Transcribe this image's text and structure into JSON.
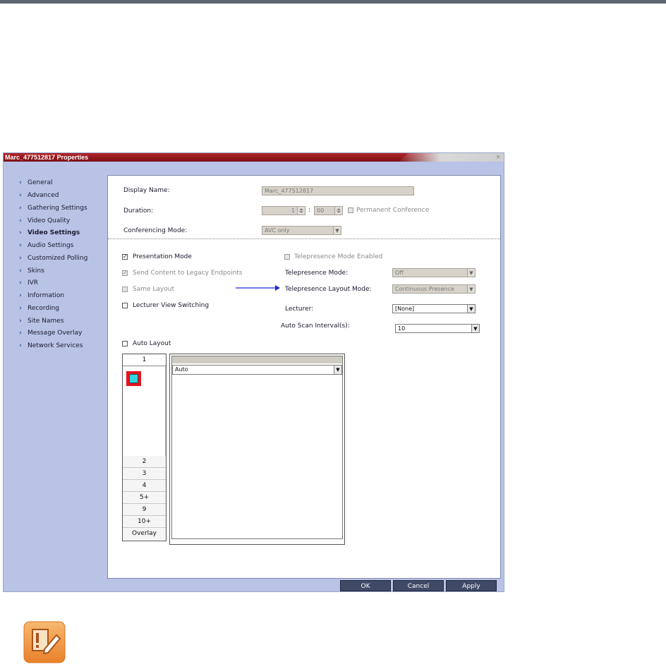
{
  "window": {
    "title": "Marc_477512817 Properties",
    "close": "×"
  },
  "sidebar": {
    "items": [
      {
        "label": "General"
      },
      {
        "label": "Advanced"
      },
      {
        "label": "Gathering Settings"
      },
      {
        "label": "Video Quality"
      },
      {
        "label": "Video Settings",
        "active": true
      },
      {
        "label": "Audio Settings"
      },
      {
        "label": "Customized Polling"
      },
      {
        "label": "Skins"
      },
      {
        "label": "IVR"
      },
      {
        "label": "Information"
      },
      {
        "label": "Recording"
      },
      {
        "label": "Site Names"
      },
      {
        "label": "Message Overlay"
      },
      {
        "label": "Network Services"
      }
    ]
  },
  "form": {
    "display_name_label": "Display Name:",
    "display_name_value": "Marc_477512817",
    "duration_label": "Duration:",
    "duration_hours": "1",
    "duration_sep": ":",
    "duration_minutes": "00",
    "permanent_label": "Permanent Conference",
    "conf_mode_label": "Conferencing Mode:",
    "conf_mode_value": "AVC only",
    "presentation_mode_label": "Presentation Mode",
    "presentation_mode_checked": "✓",
    "send_content_label": "Send Content to Legacy Endpoints",
    "send_content_checked": "✓",
    "same_layout_label": "Same Layout",
    "lecturer_view_label": "Lecturer View Switching",
    "telepresence_enabled_label": "Telepresence Mode Enabled",
    "telepresence_mode_label": "Telepresence Mode:",
    "telepresence_mode_value": "Off",
    "telepresence_layout_label": "Telepresence Layout Mode:",
    "telepresence_layout_value": "Continuous Presence",
    "lecturer_label": "Lecturer:",
    "lecturer_value": "[None]",
    "auto_scan_label": "Auto Scan Interval(s):",
    "auto_scan_value": "10",
    "auto_layout_label": "Auto Layout"
  },
  "layouts": {
    "tabs": [
      "1",
      "2",
      "3",
      "4",
      "5+",
      "9",
      "10+",
      "Overlay"
    ],
    "cell_value": "Auto"
  },
  "buttons": {
    "ok": "OK",
    "cancel": "Cancel",
    "apply": "Apply"
  },
  "colors": {
    "title_red": "#9a1a1f",
    "dialog_bg": "#b8c3e6",
    "button_navy": "#3f4a66",
    "arrow_blue": "#1c2bd6",
    "note_orange": "#f0a048"
  },
  "icons": {
    "note": "note-pencil-icon",
    "chevron": "chevron-right-icon"
  }
}
